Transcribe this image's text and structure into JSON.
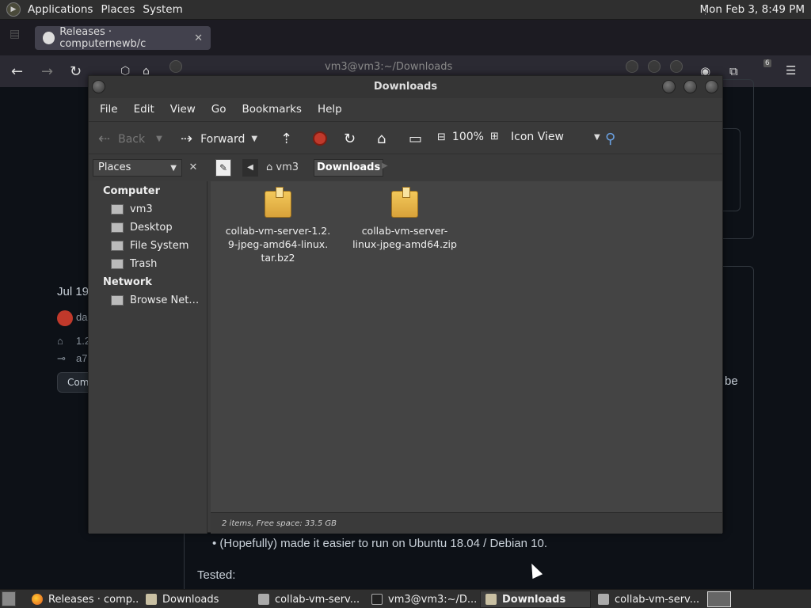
{
  "top_panel": {
    "menus": [
      "Applications",
      "Places",
      "System"
    ],
    "clock": "Mon Feb  3,  8:49 PM"
  },
  "browser": {
    "active_tab": "Releases · computernewb/c",
    "inactive_tab": "  ",
    "terminal_title": "vm3@vm3:~/Downloads",
    "ublock_count": "6"
  },
  "bg_page": {
    "release_date": "Jul 19",
    "user": "da",
    "tag": "1.2",
    "commit": "a7",
    "compare": "Com",
    "right_text": "be",
    "bullet": "(Hopefully) made it easier to run on Ubuntu 18.04 / Debian 10.",
    "tested": "Tested:"
  },
  "file_manager": {
    "title": "Downloads",
    "menus": [
      "File",
      "Edit",
      "View",
      "Go",
      "Bookmarks",
      "Help"
    ],
    "toolbar": {
      "back": "Back",
      "forward": "Forward",
      "zoom": "100%",
      "view_mode": "Icon View"
    },
    "location": {
      "side_pane": "Places",
      "crumbs": [
        "vm3",
        "Downloads"
      ]
    },
    "sidebar": {
      "computer_heading": "Computer",
      "computer_items": [
        "vm3",
        "Desktop",
        "File System",
        "Trash"
      ],
      "network_heading": "Network",
      "network_items": [
        "Browse Net…"
      ]
    },
    "files": [
      {
        "line1": "collab-vm-server-1.2.",
        "line2": "9-jpeg-amd64-linux.",
        "line3": "tar.bz2"
      },
      {
        "line1": "collab-vm-server-",
        "line2": "linux-jpeg-amd64.zip",
        "line3": ""
      }
    ],
    "status": "2 items, Free space: 33.5 GB"
  },
  "taskbar": {
    "tasks": [
      "Releases · comp...",
      "Downloads",
      "collab-vm-serv...",
      "vm3@vm3:~/D...",
      "Downloads",
      "collab-vm-serv..."
    ]
  },
  "colors": {
    "panel": "#2f2f2f",
    "window": "#3c3c3c",
    "content": "#444444",
    "github_bg": "#0d1117"
  }
}
